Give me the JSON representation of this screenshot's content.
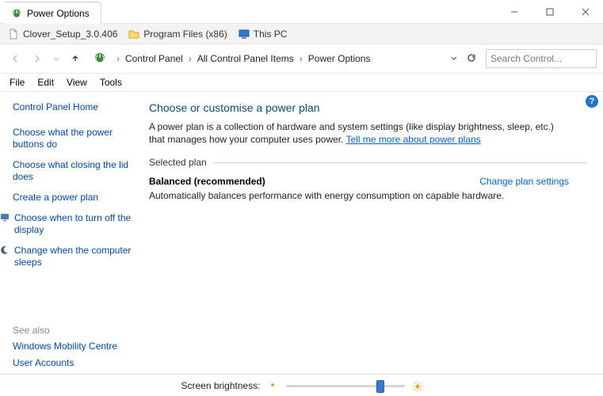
{
  "window": {
    "tab_title": "Power Options"
  },
  "bookmarks": {
    "items": [
      {
        "label": "Clover_Setup_3.0.406",
        "icon": "file"
      },
      {
        "label": "Program Files (x86)",
        "icon": "folder"
      },
      {
        "label": "This PC",
        "icon": "pc"
      }
    ]
  },
  "nav": {
    "breadcrumbs": [
      "Control Panel",
      "All Control Panel Items",
      "Power Options"
    ],
    "search_placeholder": "Search Control..."
  },
  "menubar": [
    "File",
    "Edit",
    "View",
    "Tools"
  ],
  "sidebar": {
    "home": "Control Panel Home",
    "links": [
      "Choose what the power buttons do",
      "Choose what closing the lid does",
      "Create a power plan",
      "Choose when to turn off the display",
      "Change when the computer sleeps"
    ],
    "see_also_label": "See also",
    "see_also": [
      "Windows Mobility Centre",
      "User Accounts"
    ]
  },
  "content": {
    "title": "Choose or customise a power plan",
    "description_pre": "A power plan is a collection of hardware and system settings (like display brightness, sleep, etc.) that manages how your computer uses power. ",
    "description_link": "Tell me more about power plans",
    "selected_plan_label": "Selected plan",
    "plan_name": "Balanced (recommended)",
    "change_link": "Change plan settings",
    "plan_desc": "Automatically balances performance with energy consumption on capable hardware."
  },
  "bottom": {
    "label": "Screen brightness:",
    "slider_percent": 82
  }
}
